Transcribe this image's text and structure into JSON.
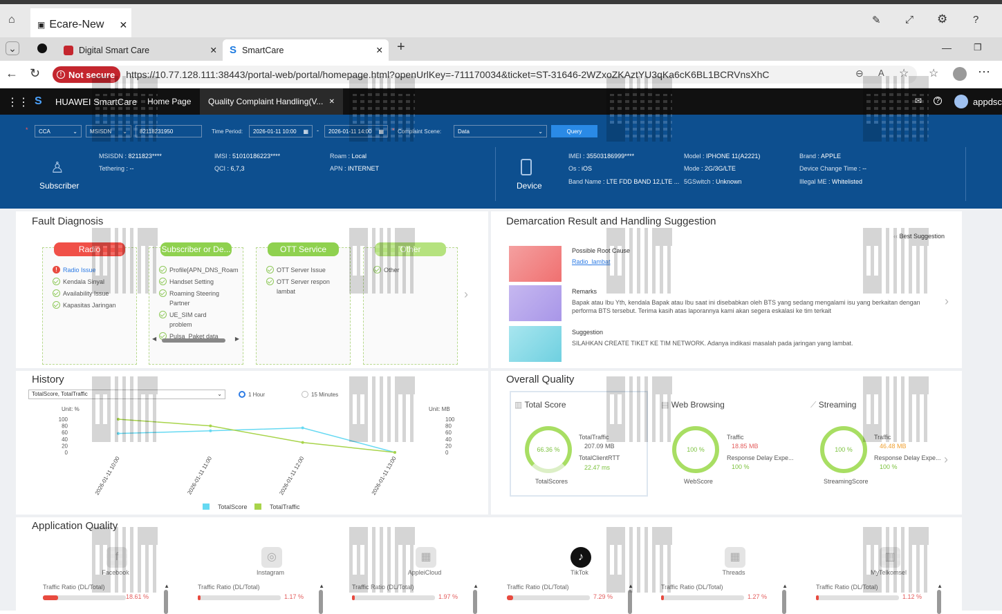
{
  "app": {
    "title": "Ecare-New"
  },
  "browser": {
    "tabs": [
      {
        "label": "Digital Smart Care"
      },
      {
        "label": "SmartCare"
      }
    ],
    "not_secure": "Not secure",
    "url": "https://10.77.128.111:38443/portal-web/portal/homepage.html?openUrlKey=-711170034&ticket=ST-31646-2WZxoZKAztYU3qKa6cK6BL1BCRVnsXhC"
  },
  "nav": {
    "brand": "HUAWEI SmartCare",
    "home": "Home Page",
    "active_tab": "Quality Complaint Handling(V...",
    "user": "appdsc"
  },
  "query": {
    "area": "CCA",
    "id_type": "MSISDN",
    "msisdn": "82118231950",
    "time_label": "Time Period:",
    "time_start": "2026-01-11 10:00",
    "time_end": "2026-01-11 14:00",
    "scene_label": "Complaint Scene:",
    "scene": "Data",
    "query_btn": "Query"
  },
  "subscriber": {
    "label": "Subscriber",
    "msisdn_k": "MSISDN",
    "msisdn_v": "8211823****",
    "tether_k": "Tethering",
    "tether_v": "--",
    "imsi_k": "IMSI",
    "imsi_v": "51010186223****",
    "qci_k": "QCI",
    "qci_v": "6,7,3",
    "roam_k": "Roam",
    "roam_v": "Local",
    "apn_k": "APN",
    "apn_v": "INTERNET"
  },
  "device": {
    "label": "Device",
    "imei_k": "IMEI",
    "imei_v": "35503186999****",
    "os_k": "Os",
    "os_v": "iOS",
    "band_k": "Band Name",
    "band_v": "LTE FDD BAND 12,LTE ...",
    "model_k": "Model",
    "model_v": "IPHONE 11(A2221)",
    "mode_k": "Mode",
    "mode_v": "2G/3G/LTE",
    "fivegs_k": "5GSwitch",
    "fivegs_v": "Unknown",
    "brand_k": "Brand",
    "brand_v": "APPLE",
    "dct_k": "Device Change Time",
    "dct_v": "--",
    "illegal_k": "Illegal ME",
    "illegal_v": "Whitelisted"
  },
  "fault": {
    "title": "Fault Diagnosis",
    "radio": {
      "label": "Radio",
      "items": [
        "Radio Issue",
        "Kendala Sinyal",
        "Availability Issue",
        "Kapasitas Jaringan"
      ]
    },
    "subscriber": {
      "label": "Subscriber or De...",
      "items": [
        "Profile[APN_DNS_Roam",
        "Handset Setting",
        "Roaming Steering Partner",
        "UE_SIM card problem",
        "Pulsa_Paket data"
      ]
    },
    "ott": {
      "label": "OTT Service",
      "items": [
        "OTT Server Issue",
        "OTT Server respon lambat"
      ]
    },
    "other": {
      "label": "Other",
      "items": [
        "Other"
      ]
    }
  },
  "demarcation": {
    "title": "Demarcation Result and Handling Suggestion",
    "best": "Best Suggestion",
    "root_label": "Possible Root Cause",
    "root_value": "Radio_lambat",
    "remarks_label": "Remarks",
    "remarks_text": "Bapak atau Ibu Yth, kendala Bapak atau Ibu saat ini disebabkan oleh BTS yang sedang mengalami isu yang berkaitan dengan performa BTS tersebut. Terima kasih atas laporannya kami akan segera eskalasi ke tim terkait",
    "suggestion_label": "Suggestion",
    "suggestion_text": "SILAHKAN CREATE TIKET KE TIM NETWORK. Adanya indikasi masalah pada jaringan yang lambat."
  },
  "history": {
    "title": "History",
    "select": "TotalScore, TotalTraffic",
    "opt1": "1 Hour",
    "opt2": "15 Minutes",
    "unit_left": "Unit: %",
    "unit_right": "Unit: MB"
  },
  "chart_data": {
    "type": "line",
    "x": [
      "2026-01-11 10:00",
      "2026-01-11 11:00",
      "2026-01-11 12:00",
      "2026-01-11 13:00"
    ],
    "series": [
      {
        "name": "TotalScore",
        "values": [
          57,
          65,
          74,
          0
        ]
      },
      {
        "name": "TotalTraffic",
        "values": [
          100,
          80,
          30,
          0
        ]
      }
    ],
    "ylim": [
      0,
      100
    ],
    "yticks": [
      "100",
      "80",
      "60",
      "40",
      "20",
      "0"
    ],
    "ylim_right": [
      0,
      100
    ],
    "colors": {
      "TotalScore": "#66d9f2",
      "TotalTraffic": "#a8d44a"
    }
  },
  "overall": {
    "title": "Overall Quality",
    "total": {
      "label": "Total Score",
      "score": "66.36 %",
      "score_label": "TotalScores",
      "traffic_k": "TotalTraffic",
      "traffic_v": "207.09 MB",
      "rtt_k": "TotalClientRTT",
      "rtt_v": "22.47 ms"
    },
    "web": {
      "label": "Web Browsing",
      "score": "100 %",
      "score_label": "WebScore",
      "traffic_k": "Traffic",
      "traffic_v": "18.85 MB",
      "delay_k": "Response Delay Expe...",
      "delay_v": "100 %"
    },
    "stream": {
      "label": "Streaming",
      "score": "100 %",
      "score_label": "StreamingScore",
      "traffic_k": "Traffic",
      "traffic_v": "46.48 MB",
      "delay_k": "Response Delay Expe...",
      "delay_v": "100 %"
    }
  },
  "apps": {
    "title": "Application Quality",
    "ratio_label": "Traffic Ratio (DL/Total)",
    "list": [
      {
        "name": "Facebook",
        "pct": "18.61 %",
        "ratio": 0.1861
      },
      {
        "name": "Instagram",
        "pct": "1.17 %",
        "ratio": 0.0117
      },
      {
        "name": "AppleiCloud",
        "pct": "1.97 %",
        "ratio": 0.0197
      },
      {
        "name": "TikTok",
        "pct": "7.29 %",
        "ratio": 0.0729
      },
      {
        "name": "Threads",
        "pct": "1.27 %",
        "ratio": 0.0127
      },
      {
        "name": "MyTelkomsel",
        "pct": "1.12 %",
        "ratio": 0.0112
      }
    ]
  },
  "watermark": {
    "text": "appdsc 2026-01-11 15:19:15"
  }
}
